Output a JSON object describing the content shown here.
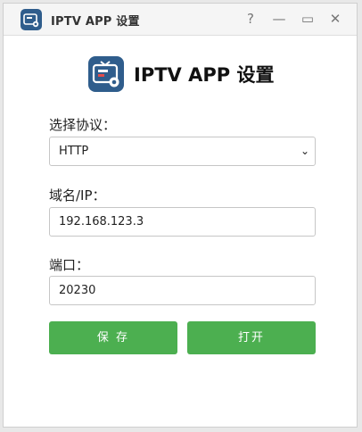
{
  "window": {
    "title": "IPTV APP 设置",
    "controls": {
      "help": "?",
      "minimize": "—",
      "maximize": "▭",
      "close": "✕"
    }
  },
  "header": {
    "title": "IPTV APP 设置"
  },
  "form": {
    "protocol": {
      "label": "选择协议：",
      "value": "HTTP",
      "arrow": "⌄"
    },
    "domain": {
      "label": "域名/IP：",
      "value": "192.168.123.3"
    },
    "port": {
      "label": "端口：",
      "value": "20230"
    }
  },
  "buttons": {
    "save": "保 存",
    "open": "打开"
  },
  "colors": {
    "accent": "#4caf50",
    "icon": "#2f5d8c"
  }
}
